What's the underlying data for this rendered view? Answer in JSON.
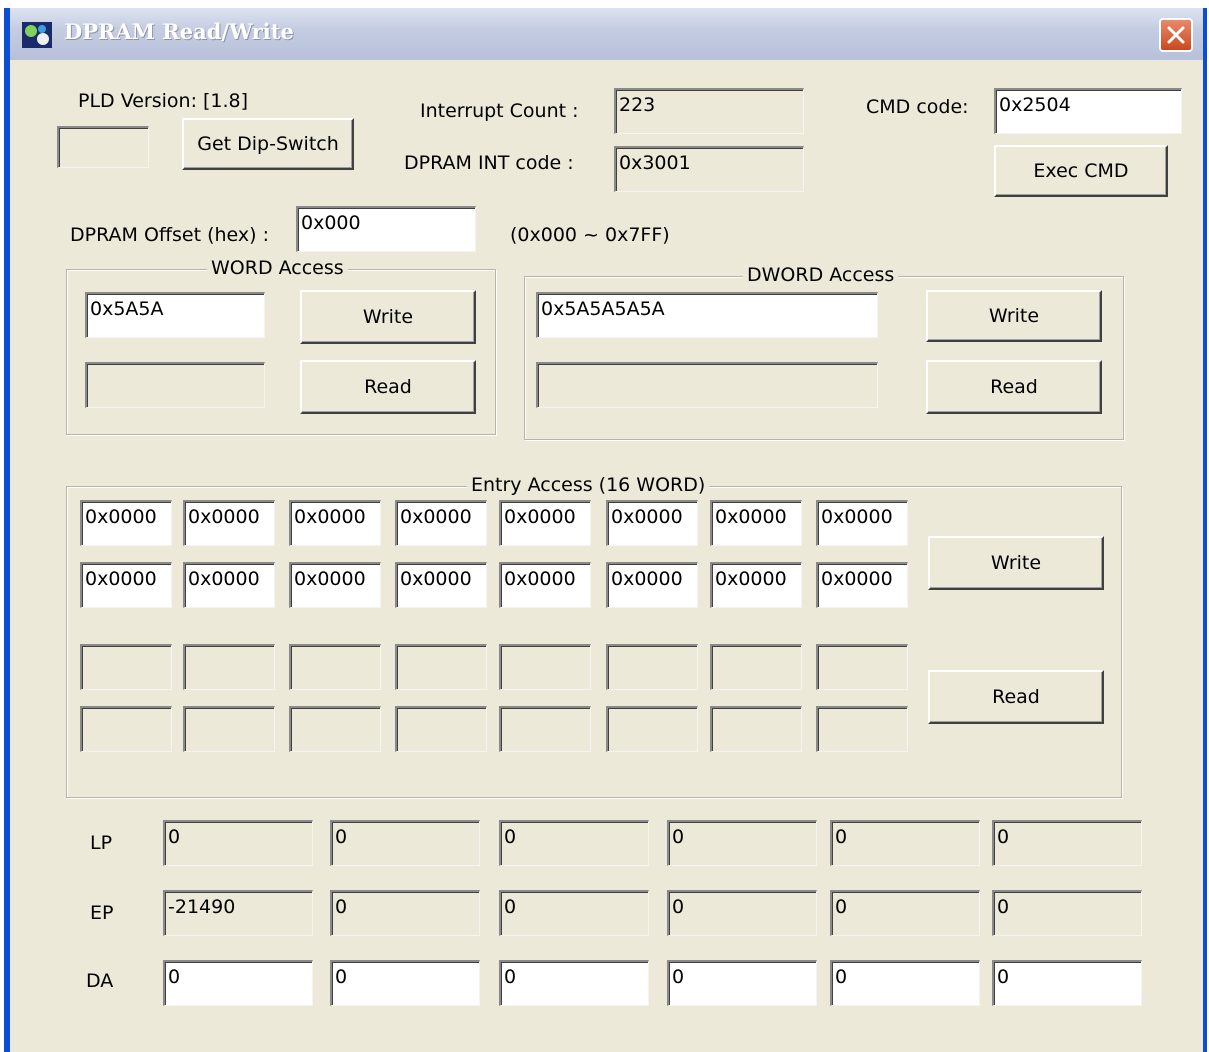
{
  "window": {
    "title": "DPRAM Read/Write"
  },
  "header": {
    "pld_version": "PLD Version: [1.8]",
    "dip_switch_value": "",
    "get_dip_switch_label": "Get Dip-Switch",
    "interrupt_count_label": "Interrupt Count :",
    "interrupt_count_value": "223",
    "int_code_label": "DPRAM INT code :",
    "int_code_value": "0x3001",
    "cmd_code_label": "CMD code:",
    "cmd_code_value": "0x2504",
    "exec_cmd_label": "Exec CMD"
  },
  "offset": {
    "label": "DPRAM Offset (hex) :",
    "value": "0x000",
    "range": "(0x000 ~ 0x7FF)"
  },
  "word_access": {
    "title": "WORD Access",
    "write_value": "0x5A5A",
    "read_value": "",
    "write_label": "Write",
    "read_label": "Read"
  },
  "dword_access": {
    "title": "DWORD Access",
    "write_value": "0x5A5A5A5A",
    "read_value": "",
    "write_label": "Write",
    "read_label": "Read"
  },
  "entry_access": {
    "title": "Entry Access (16 WORD)",
    "write_row1": [
      "0x0000",
      "0x0000",
      "0x0000",
      "0x0000",
      "0x0000",
      "0x0000",
      "0x0000",
      "0x0000"
    ],
    "write_row2": [
      "0x0000",
      "0x0000",
      "0x0000",
      "0x0000",
      "0x0000",
      "0x0000",
      "0x0000",
      "0x0000"
    ],
    "read_row1": [
      "",
      "",
      "",
      "",
      "",
      "",
      "",
      ""
    ],
    "read_row2": [
      "",
      "",
      "",
      "",
      "",
      "",
      "",
      ""
    ],
    "write_label": "Write",
    "read_label": "Read"
  },
  "axes": {
    "lp": {
      "label": "LP",
      "values": [
        "0",
        "0",
        "0",
        "0",
        "0",
        "0"
      ]
    },
    "ep": {
      "label": "EP",
      "values": [
        "-21490",
        "0",
        "0",
        "0",
        "0",
        "0"
      ]
    },
    "da": {
      "label": "DA",
      "values": [
        "0",
        "0",
        "0",
        "0",
        "0",
        "0"
      ]
    }
  },
  "colors": {
    "title_bar": "#c5cde2",
    "window_border": "#0a4fd3",
    "dialog_bg": "#ece9d8",
    "close_button": "#d0582c"
  }
}
